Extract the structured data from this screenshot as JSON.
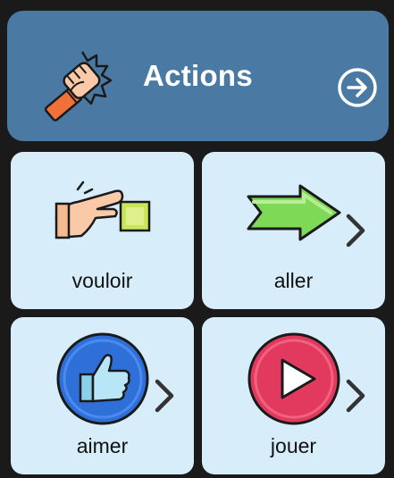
{
  "header": {
    "title": "Actions",
    "icon": "raised-fist-icon",
    "next_icon": "arrow-circle-right-icon",
    "background": "#4a7aa3"
  },
  "tiles": [
    {
      "label": "vouloir",
      "icon": "hand-reaching-box-icon",
      "has_submenu": false
    },
    {
      "label": "aller",
      "icon": "green-arrow-right-icon",
      "has_submenu": true
    },
    {
      "label": "aimer",
      "icon": "thumbs-up-icon",
      "has_submenu": true
    },
    {
      "label": "jouer",
      "icon": "play-button-icon",
      "has_submenu": true
    }
  ],
  "colors": {
    "background": "#1a1a1a",
    "tile_background": "#d7edf9"
  }
}
